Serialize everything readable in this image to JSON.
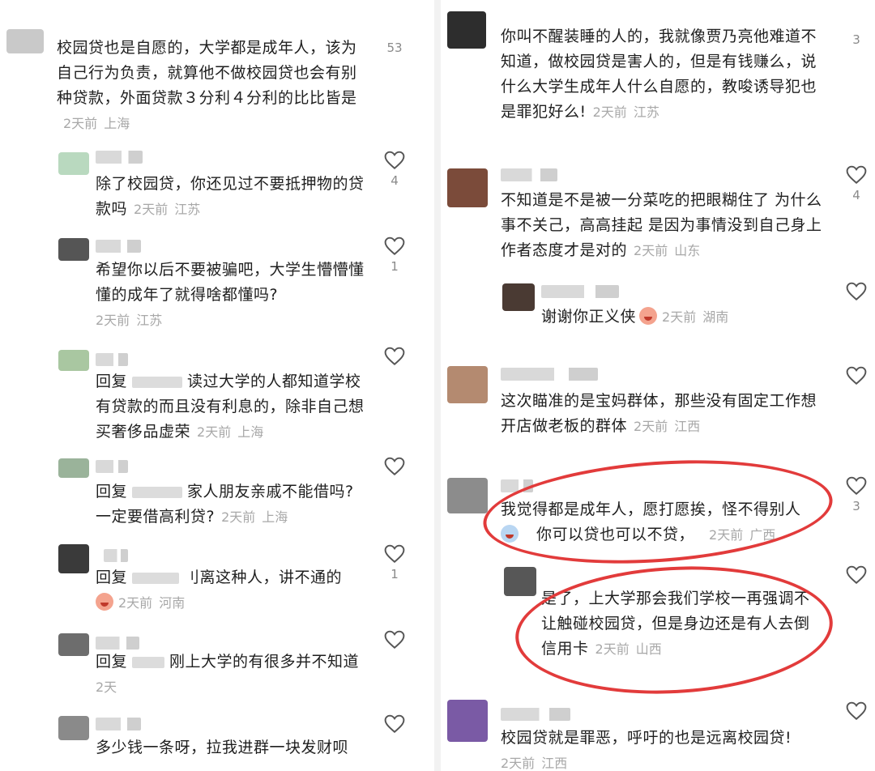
{
  "left": {
    "comments": [
      {
        "text": "校园贷也是自愿的，大学都是成年人，该为自己行为负责，就算他不做校园贷也会有别种贷款，外面贷款３分利４分利的比比皆是",
        "time": "2天前",
        "location": "上海",
        "likes": "53"
      },
      {
        "text": "除了校园贷，你还见过不要抵押物的贷款吗",
        "time": "2天前",
        "location": "江苏",
        "likes": "4"
      },
      {
        "text": "希望你以后不要被骗吧，大学生懵懵懂懂的成年了就得啥都懂吗?",
        "time": "2天前",
        "location": "江苏",
        "likes": "1"
      },
      {
        "reply_prefix": "回复",
        "text": "读过大学的人都知道学校有贷款的而且没有利息的，除非自己想买奢侈品虚荣",
        "time": "2天前",
        "location": "上海",
        "likes": ""
      },
      {
        "reply_prefix": "回复",
        "text": "家人朋友亲戚不能借吗? 一定要借高利贷?",
        "time": "2天前",
        "location": "上海",
        "likes": ""
      },
      {
        "reply_prefix": "回复",
        "text": "刂离这种人，讲不通的",
        "time": "2天前",
        "location": "河南",
        "likes": "1"
      },
      {
        "reply_prefix": "回复",
        "text": "刚上大学的有很多并不知道",
        "time": "2天",
        "location": "",
        "likes": ""
      },
      {
        "text": "多少钱一条呀，拉我进群一块发财呗",
        "time": "",
        "location": "",
        "likes": ""
      }
    ]
  },
  "right": {
    "comments": [
      {
        "text": "你叫不醒装睡的人的，我就像贾乃亮他难道不知道，做校园贷是害人的，但是有钱赚么，说什么大学生成年人什么自愿的，教唆诱导犯也是罪犯好么!",
        "time": "2天前",
        "location": "江苏",
        "likes": "3"
      },
      {
        "text": "不知道是不是被一分菜吃的把眼糊住了 为什么事不关己，高高挂起 是因为事情没到自己身上 作者态度才是对的",
        "time": "2天前",
        "location": "山东",
        "likes": "4"
      },
      {
        "text": "谢谢你正义侠",
        "time": "2天前",
        "location": "湖南",
        "likes": ""
      },
      {
        "text": "这次瞄准的是宝妈群体，那些没有固定工作想开店做老板的群体",
        "time": "2天前",
        "location": "江西",
        "likes": ""
      },
      {
        "text": "我觉得都是成年人，愿打愿挨，怪不得别人",
        "text2": "你可以贷也可以不贷，",
        "time": "2天前",
        "location": "广西",
        "likes": "3"
      },
      {
        "text": "是了，上大学那会我们学校一再强调不让触碰校园贷，但是身边还是有人去倒信用卡",
        "time": "2天前",
        "location": "山西",
        "likes": ""
      },
      {
        "text": "校园贷就是罪恶，呼吁的也是远离校园贷!",
        "time": "2天前",
        "location": "江西",
        "likes": ""
      }
    ]
  },
  "colors": {
    "annotation": "#e23b3b",
    "meta": "#a8a8a8",
    "text": "#1f1f1f"
  }
}
